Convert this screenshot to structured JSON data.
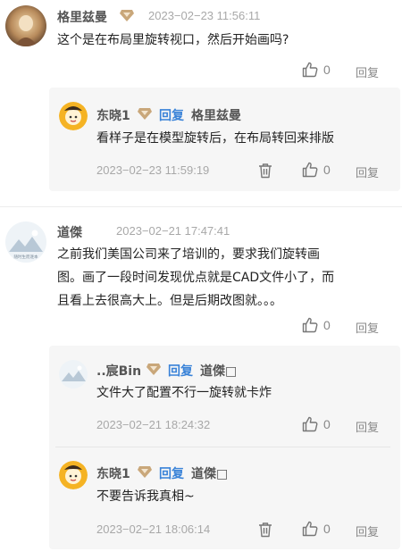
{
  "comments": [
    {
      "author": "格里兹曼",
      "time": "2023−02−23 11:56:11",
      "text": "这个是在布局里旋转视口，然后开始画吗?",
      "likes": "0",
      "reply_label": "回复",
      "replies": [
        {
          "author": "东晓1",
          "reply_word": "回复",
          "reply_to": "格里兹曼",
          "text": "看样子是在模型旋转后，在布局转回来排版",
          "time": "2023−02−23 11:59:19",
          "likes": "0",
          "reply_label": "回复"
        }
      ]
    },
    {
      "author": "道傑",
      "time": "2023−02−21 17:47:41",
      "text_lines": [
        "之前我们美国公司来了培训的，要求我们旋转画",
        "图。画了一段时间发现优点就是CAD文件小了，而",
        "且看上去很高大上。但是后期改图就。。。"
      ],
      "likes": "0",
      "reply_label": "回复",
      "avatar_caption": "随时生而逐本",
      "replies": [
        {
          "author": "..宸Bin",
          "reply_word": "回复",
          "reply_to": "道傑□",
          "text": "文件大了配置不行一旋转就卡炸",
          "time": "2023−02−21 18:24:32",
          "likes": "0",
          "reply_label": "回复"
        },
        {
          "author": "东晓1",
          "reply_word": "回复",
          "reply_to": "道傑□",
          "text": "不要告诉我真相~",
          "time": "2023−02−21 18:06:14",
          "likes": "0",
          "reply_label": "回复"
        }
      ]
    }
  ],
  "colors": {
    "reply_blue": "#3a83d8",
    "badge_gold": "#c9a77a",
    "sub_bg": "#f6f6f6"
  }
}
